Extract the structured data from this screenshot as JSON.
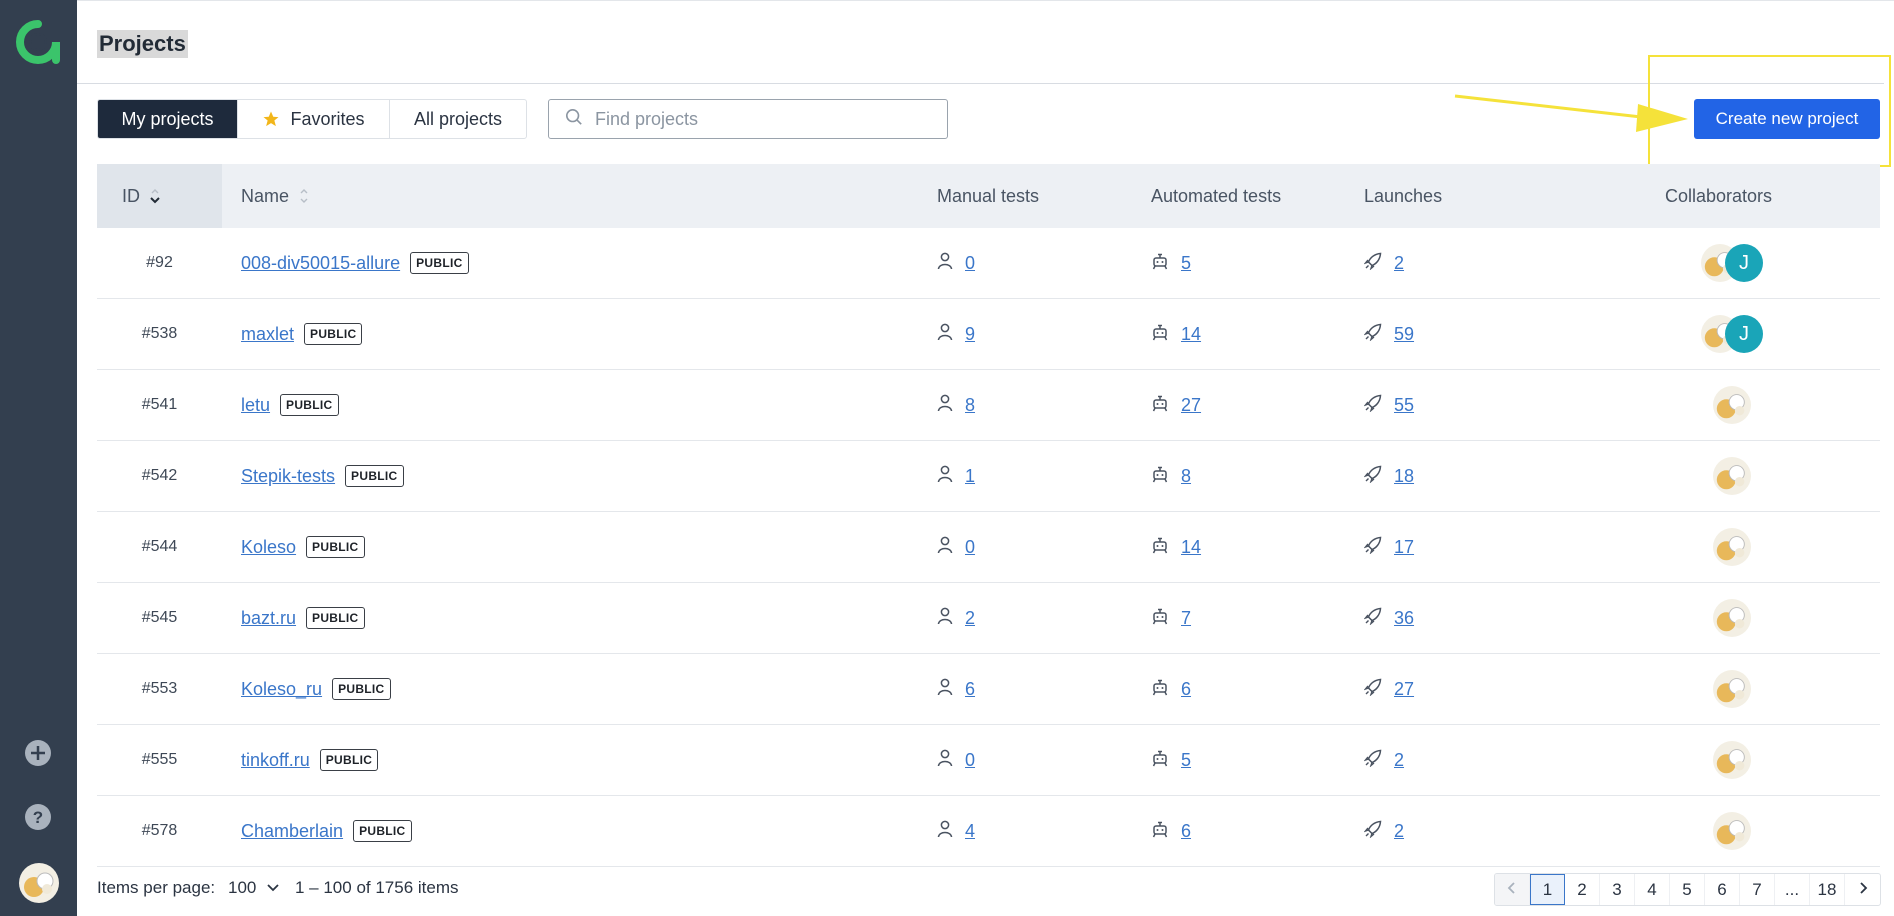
{
  "page": {
    "title": "Projects"
  },
  "tabs": [
    {
      "label": "My projects",
      "active": true
    },
    {
      "label": "Favorites",
      "icon": "star-icon"
    },
    {
      "label": "All projects"
    }
  ],
  "search": {
    "placeholder": "Find projects",
    "value": ""
  },
  "actions": {
    "create_label": "Create new project"
  },
  "colors": {
    "sidebar": "#333f4f",
    "accent": "#2264e6",
    "link": "#3a76c9",
    "annotation": "#f5e23a",
    "brand": "#3bc46b"
  },
  "table": {
    "columns": {
      "id": "ID",
      "name": "Name",
      "manual": "Manual tests",
      "automated": "Automated tests",
      "launches": "Launches",
      "collaborators": "Collaborators"
    },
    "rows": [
      {
        "id": "#92",
        "name": "008-div50015-allure",
        "badge": "PUBLIC",
        "manual": "0",
        "automated": "5",
        "launches": "2",
        "extra_collaborator": "J"
      },
      {
        "id": "#538",
        "name": "maxlet",
        "badge": "PUBLIC",
        "manual": "9",
        "automated": "14",
        "launches": "59",
        "extra_collaborator": "J"
      },
      {
        "id": "#541",
        "name": "letu",
        "badge": "PUBLIC",
        "manual": "8",
        "automated": "27",
        "launches": "55"
      },
      {
        "id": "#542",
        "name": "Stepik-tests",
        "badge": "PUBLIC",
        "manual": "1",
        "automated": "8",
        "launches": "18"
      },
      {
        "id": "#544",
        "name": "Koleso",
        "badge": "PUBLIC",
        "manual": "0",
        "automated": "14",
        "launches": "17"
      },
      {
        "id": "#545",
        "name": "bazt.ru",
        "badge": "PUBLIC",
        "manual": "2",
        "automated": "7",
        "launches": "36"
      },
      {
        "id": "#553",
        "name": "Koleso_ru",
        "badge": "PUBLIC",
        "manual": "6",
        "automated": "6",
        "launches": "27"
      },
      {
        "id": "#555",
        "name": "tinkoff.ru",
        "badge": "PUBLIC",
        "manual": "0",
        "automated": "5",
        "launches": "2"
      },
      {
        "id": "#578",
        "name": "Chamberlain",
        "badge": "PUBLIC",
        "manual": "4",
        "automated": "6",
        "launches": "2"
      }
    ]
  },
  "footer": {
    "per_page_label": "Items per page:",
    "per_page_value": "100",
    "range": "1 – 100 of 1756 items",
    "pages": [
      "1",
      "2",
      "3",
      "4",
      "5",
      "6",
      "7",
      "...",
      "18"
    ],
    "current_page": "1"
  }
}
